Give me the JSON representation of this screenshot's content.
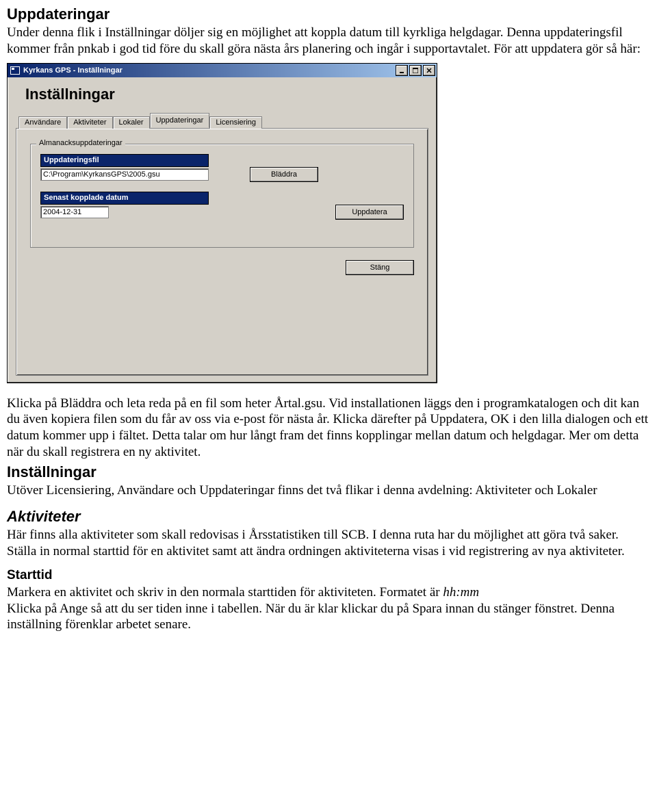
{
  "doc": {
    "h_uppdateringar": "Uppdateringar",
    "p_uppdateringar": "Under denna flik i Inställningar döljer sig en möjlighet att koppla datum till kyrkliga helgdagar. Denna uppdateringsfil kommer från pnkab i god tid före du skall göra nästa års planering och ingår i supportavtalet. För att uppdatera gör så här:",
    "p_after": "Klicka på Bläddra och leta reda på en fil som heter Årtal.gsu. Vid installationen läggs den i programkatalogen och dit kan du även kopiera filen som du får av oss via e-post för nästa år. Klicka därefter på Uppdatera, OK i den lilla dialogen och ett datum kommer upp i fältet. Detta talar om hur långt fram det finns kopplingar mellan datum och helgdagar. Mer om detta när du skall registrera en ny aktivitet.",
    "h_installningar": "Inställningar",
    "p_installningar": "Utöver Licensiering, Användare och Uppdateringar finns det två flikar i denna avdelning: Aktiviteter och Lokaler",
    "h_aktiviteter": "Aktiviteter",
    "p_aktiviteter": "Här finns alla aktiviteter som skall redovisas i Årsstatistiken till SCB. I denna ruta har du möjlighet att göra två saker. Ställa in normal starttid för en aktivitet samt att ändra ordningen aktiviteterna visas i vid registrering av nya aktiviteter.",
    "h_starttid": "Starttid",
    "p_starttid_a": "Markera en aktivitet och skriv in den normala starttiden för aktiviteten. Formatet är ",
    "p_starttid_format": "hh:mm",
    "p_starttid_b": "Klicka på Ange så att du ser tiden inne i tabellen. När du är klar klickar du på Spara innan du stänger fönstret. Denna inställning förenklar arbetet senare."
  },
  "dialog": {
    "title": "Kyrkans GPS - Inställningar",
    "heading": "Inställningar",
    "tabs": [
      "Användare",
      "Aktiviteter",
      "Lokaler",
      "Uppdateringar",
      "Licensiering"
    ],
    "group_legend": "Almanacksuppdateringar",
    "field1_label": "Uppdateringsfil",
    "field1_value": "C:\\Program\\KyrkansGPS\\2005.gsu",
    "btn_browse": "Bläddra",
    "field2_label": "Senast kopplade datum",
    "field2_value": "2004-12-31",
    "btn_update": "Uppdatera",
    "btn_close": "Stäng"
  }
}
